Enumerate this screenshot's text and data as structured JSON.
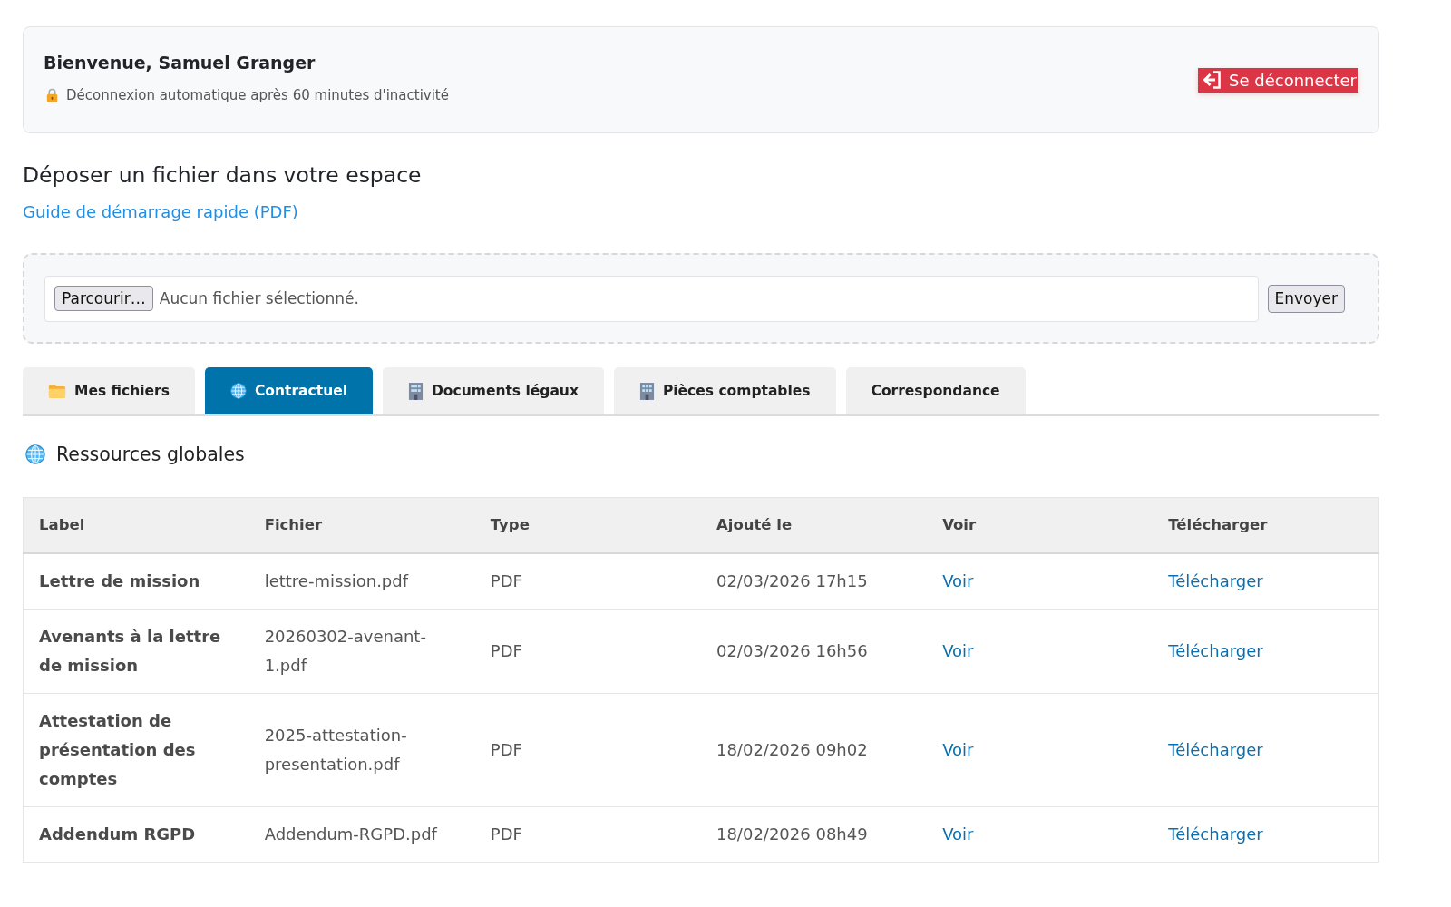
{
  "header": {
    "title": "Bienvenue, Samuel Granger",
    "notice": "Déconnexion automatique après 60 minutes d'inactivité",
    "logout_button": "Se déconnecter"
  },
  "upload": {
    "heading": "Déposer un fichier dans votre espace",
    "guide_link": "Guide de démarrage rapide (PDF)",
    "browse_button": "Parcourir…",
    "file_status": "Aucun fichier sélectionné.",
    "send_button": "Envoyer"
  },
  "tabs": [
    {
      "label": "Mes fichiers",
      "kind": "folder",
      "selected": false
    },
    {
      "label": "Contractuel",
      "kind": "globe",
      "selected": true
    },
    {
      "label": "Documents légaux",
      "kind": "building",
      "selected": false
    },
    {
      "label": "Pièces comptables",
      "kind": "building",
      "selected": false
    },
    {
      "label": "Correspondance",
      "kind": "plain",
      "selected": false
    }
  ],
  "section": {
    "title": "Ressources globales"
  },
  "table": {
    "columns": [
      "Label",
      "Fichier",
      "Type",
      "Ajouté le",
      "Voir",
      "Télécharger"
    ],
    "rows": [
      {
        "label": "Lettre de mission",
        "file": "lettre-mission.pdf",
        "type": "PDF",
        "added": "02/03/2026 17h15",
        "view": "Voir",
        "download": "Télécharger"
      },
      {
        "label": "Avenants à la lettre de mission",
        "file": "20260302-avenant-1.pdf",
        "type": "PDF",
        "added": "02/03/2026 16h56",
        "view": "Voir",
        "download": "Télécharger"
      },
      {
        "label": "Attestation de présentation des comptes",
        "file": "2025-attestation-presentation.pdf",
        "type": "PDF",
        "added": "18/02/2026 09h02",
        "view": "Voir",
        "download": "Télécharger"
      },
      {
        "label": "Addendum RGPD",
        "file": "Addendum-RGPD.pdf",
        "type": "PDF",
        "added": "18/02/2026 08h49",
        "view": "Voir",
        "download": "Télécharger"
      }
    ]
  }
}
